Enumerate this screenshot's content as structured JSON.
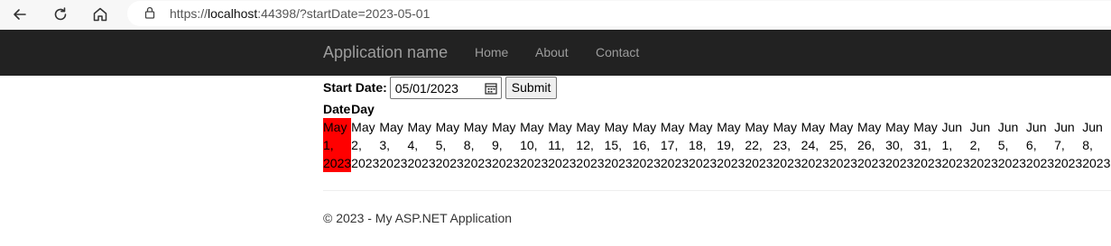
{
  "browser": {
    "url_prefix": "https://",
    "url_host": "localhost",
    "url_rest": ":44398/?startDate=2023-05-01",
    "icons": [
      "back-icon",
      "reload-icon",
      "home-icon",
      "lock-icon"
    ]
  },
  "navbar": {
    "brand": "Application name",
    "links": [
      "Home",
      "About",
      "Contact"
    ]
  },
  "form": {
    "label": "Start Date:",
    "date_value": "05/01/2023",
    "submit_label": "Submit"
  },
  "table": {
    "headers": [
      "Date",
      "Day"
    ],
    "cells": [
      [
        "May",
        "1,",
        "2023"
      ],
      [
        "May",
        "2,",
        "2023"
      ],
      [
        "May",
        "3,",
        "2023"
      ],
      [
        "May",
        "4,",
        "2023"
      ],
      [
        "May",
        "5,",
        "2023"
      ],
      [
        "May",
        "8,",
        "2023"
      ],
      [
        "May",
        "9,",
        "2023"
      ],
      [
        "May",
        "10,",
        "2023"
      ],
      [
        "May",
        "11,",
        "2023"
      ],
      [
        "May",
        "12,",
        "2023"
      ],
      [
        "May",
        "15,",
        "2023"
      ],
      [
        "May",
        "16,",
        "2023"
      ],
      [
        "May",
        "17,",
        "2023"
      ],
      [
        "May",
        "18,",
        "2023"
      ],
      [
        "May",
        "19,",
        "2023"
      ],
      [
        "May",
        "22,",
        "2023"
      ],
      [
        "May",
        "23,",
        "2023"
      ],
      [
        "May",
        "24,",
        "2023"
      ],
      [
        "May",
        "25,",
        "2023"
      ],
      [
        "May",
        "26,",
        "2023"
      ],
      [
        "May",
        "30,",
        "2023"
      ],
      [
        "May",
        "31,",
        "2023"
      ],
      [
        "Jun",
        "1,",
        "2023"
      ],
      [
        "Jun",
        "2,",
        "2023"
      ],
      [
        "Jun",
        "5,",
        "2023"
      ],
      [
        "Jun",
        "6,",
        "2023"
      ],
      [
        "Jun",
        "7,",
        "2023"
      ],
      [
        "Jun",
        "8,",
        "2023"
      ]
    ],
    "highlight_color": "#ff0000"
  },
  "footer": {
    "text": "© 2023 - My ASP.NET Application"
  },
  "colors": {
    "navbar_bg": "#222222",
    "navbar_text": "#9d9d9d",
    "highlight": "#ff0000"
  }
}
